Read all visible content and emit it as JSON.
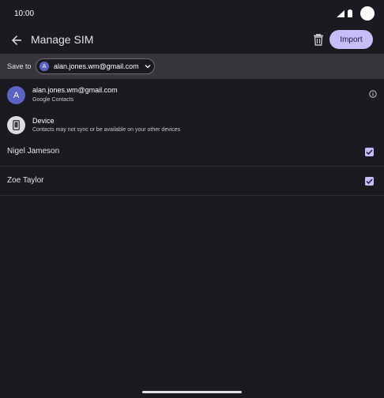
{
  "status_bar": {
    "time": "10:00"
  },
  "app_bar": {
    "title": "Manage SIM",
    "import_label": "Import"
  },
  "save_to": {
    "label": "Save to",
    "account_initial": "A",
    "account_email": "alan.jones.wm@gmail.com"
  },
  "accounts": {
    "google": {
      "initial": "A",
      "email": "alan.jones.wm@gmail.com",
      "subtitle": "Google Contacts"
    },
    "device": {
      "title": "Device",
      "subtitle": "Contacts may not sync or be available on your other devices"
    }
  },
  "contacts": [
    {
      "name": "Nigel Jameson",
      "checked": true
    },
    {
      "name": "Zoe Taylor",
      "checked": true
    }
  ],
  "colors": {
    "background": "#1b1a21",
    "accent": "#c6bff7",
    "avatar": "#5b64c4"
  },
  "icons": [
    "back-arrow-icon",
    "trash-icon",
    "chevron-down-icon",
    "info-icon",
    "phone-icon",
    "check-icon"
  ]
}
